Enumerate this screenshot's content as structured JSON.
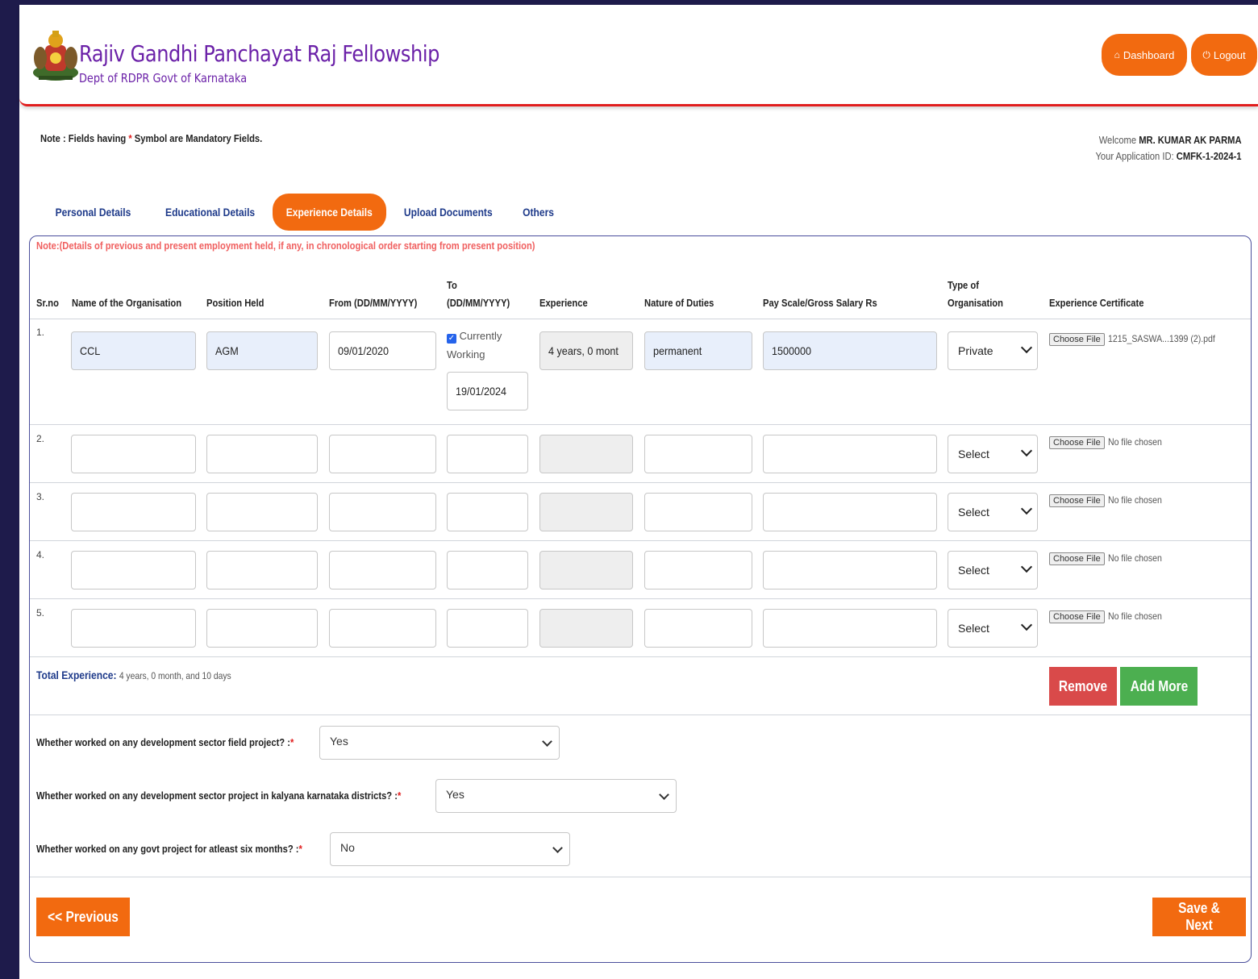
{
  "header": {
    "title": "Rajiv Gandhi Panchayat Raj Fellowship",
    "subtitle": "Dept of RDPR Govt of Karnataka",
    "dashboard_label": "Dashboard",
    "logout_label": "Logout"
  },
  "note": {
    "prefix": "Note : Fields having",
    "star": "*",
    "suffix": "Symbol are Mandatory Fields."
  },
  "welcome": {
    "welcome_label": "Welcome",
    "user_name": "MR. KUMAR AK PARMA",
    "app_id_label": "Your Application ID:",
    "app_id": "CMFK-1-2024-1"
  },
  "tabs": [
    "Personal Details",
    "Educational Details",
    "Experience Details",
    "Upload Documents",
    "Others"
  ],
  "panel_note": "Note:(Details of previous and present employment held, if any, in chronological order starting from present position)",
  "table": {
    "headers": {
      "srno": "Sr.no",
      "org": "Name of the Organisation",
      "position": "Position Held",
      "from": "From (DD/MM/YYYY)",
      "to_line1": "To",
      "to_line2": "(DD/MM/YYYY)",
      "experience": "Experience",
      "duties": "Nature of Duties",
      "pay": "Pay Scale/Gross Salary Rs",
      "type_line1": "Type of",
      "type_line2": "Organisation",
      "cert": "Experience Certificate"
    },
    "rows": [
      {
        "sr": "1.",
        "org": "CCL",
        "position": "AGM",
        "from": "09/01/2020",
        "to": "19/01/2024",
        "currently_working": "Currently Working",
        "experience": "4 years, 0 mont",
        "duties": "permanent",
        "pay": "1500000",
        "type": "Private",
        "file_button": "Choose File",
        "file": "1215_SASWA...1399 (2).pdf"
      },
      {
        "sr": "2.",
        "org": "",
        "position": "",
        "from": "",
        "to": "",
        "experience": "",
        "duties": "",
        "pay": "",
        "type": "Select",
        "file_button": "Choose File",
        "file": "No file chosen"
      },
      {
        "sr": "3.",
        "org": "",
        "position": "",
        "from": "",
        "to": "",
        "experience": "",
        "duties": "",
        "pay": "",
        "type": "Select",
        "file_button": "Choose File",
        "file": "No file chosen"
      },
      {
        "sr": "4.",
        "org": "",
        "position": "",
        "from": "",
        "to": "",
        "experience": "",
        "duties": "",
        "pay": "",
        "type": "Select",
        "file_button": "Choose File",
        "file": "No file chosen"
      },
      {
        "sr": "5.",
        "org": "",
        "position": "",
        "from": "",
        "to": "",
        "experience": "",
        "duties": "",
        "pay": "",
        "type": "Select",
        "file_button": "Choose File",
        "file": "No file chosen"
      }
    ]
  },
  "total": {
    "label": "Total Experience:",
    "value": "4 years, 0 month, and 10 days"
  },
  "buttons": {
    "remove": "Remove",
    "add_more": "Add More",
    "previous": "<< Previous",
    "save_next": "Save & Next"
  },
  "questions": [
    {
      "text": "Whether worked on any development sector field project? :",
      "star": "*",
      "answer": "Yes"
    },
    {
      "text": "Whether worked on any development sector project in kalyana karnataka districts? :",
      "star": "*",
      "answer": "Yes"
    },
    {
      "text": "Whether worked on any govt project for atleast six months? :",
      "star": "*",
      "answer": "No"
    }
  ],
  "colors": {
    "accent": "#f26a10",
    "brand": "#6b21a8",
    "tab_text": "#1e3a8a",
    "remove": "#d94a4a",
    "add": "#4caf50",
    "header_rule": "#e11d1d"
  },
  "icons": {
    "emblem": "karnataka-emblem-icon",
    "dashboard": "home-icon",
    "logout": "power-icon"
  }
}
